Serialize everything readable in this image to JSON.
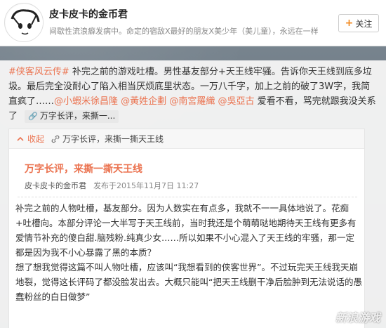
{
  "profile": {
    "name": "皮卡皮卡的金币君",
    "bio": "间歇性流浪癖发病中。命定的宿敌X最好的朋友X美少年（美儿童），永远在一样",
    "follow_label": "关注"
  },
  "post": {
    "hashtag": "#侠客风云传#",
    "text_1": " 补完之前的游戏吐槽。男性基友部分+天王线牢骚。告诉你天王线到底多垃圾。最后完全没耐心了陷入相当厌烦底里状态。一万八千字，加上之前的破了3W字，我简直疯了……",
    "mentions": [
      "@小蝦米徐昌隆",
      "@黃姓企劃",
      "@南宮羅織",
      "@吳亞古"
    ],
    "text_2": " 爱看不看，骂完就跟我没关系了",
    "chip_label": "万字长评，来撕一..."
  },
  "quote": {
    "collapse_label": "收起",
    "bar_title": "万字长评，来撕一撕天王线",
    "title": "万字长评，来撕一撕天王线",
    "author": "皮卡皮卡的金币君",
    "published": "发布于2015年11月7日 11:27",
    "paragraphs": [
      "补完之前的人物吐槽，基友部分。因为人数实在有点多，我就不一一具体地说了。花痴+吐槽向。本部分评论一大半写于天王线前，当时我还是个萌萌哒地期待天王线有更多有爱情节补充的傻白甜.脑残粉.纯真少女……所以如果不小心混入了天王线的牢骚，那一定都是因为我不小心暴露了黑的本质？",
      "想了想我觉得这篇不叫人物吐槽，应该叫“我想看到的侠客世界”。不过玩完天王线我天崩地裂，觉得这长评码了都没脸发出去。大概只能叫“把天王线删干净后脸肿到无法说话的愚蠢粉丝的白日做梦”"
    ]
  },
  "watermark": "新浪游戏"
}
